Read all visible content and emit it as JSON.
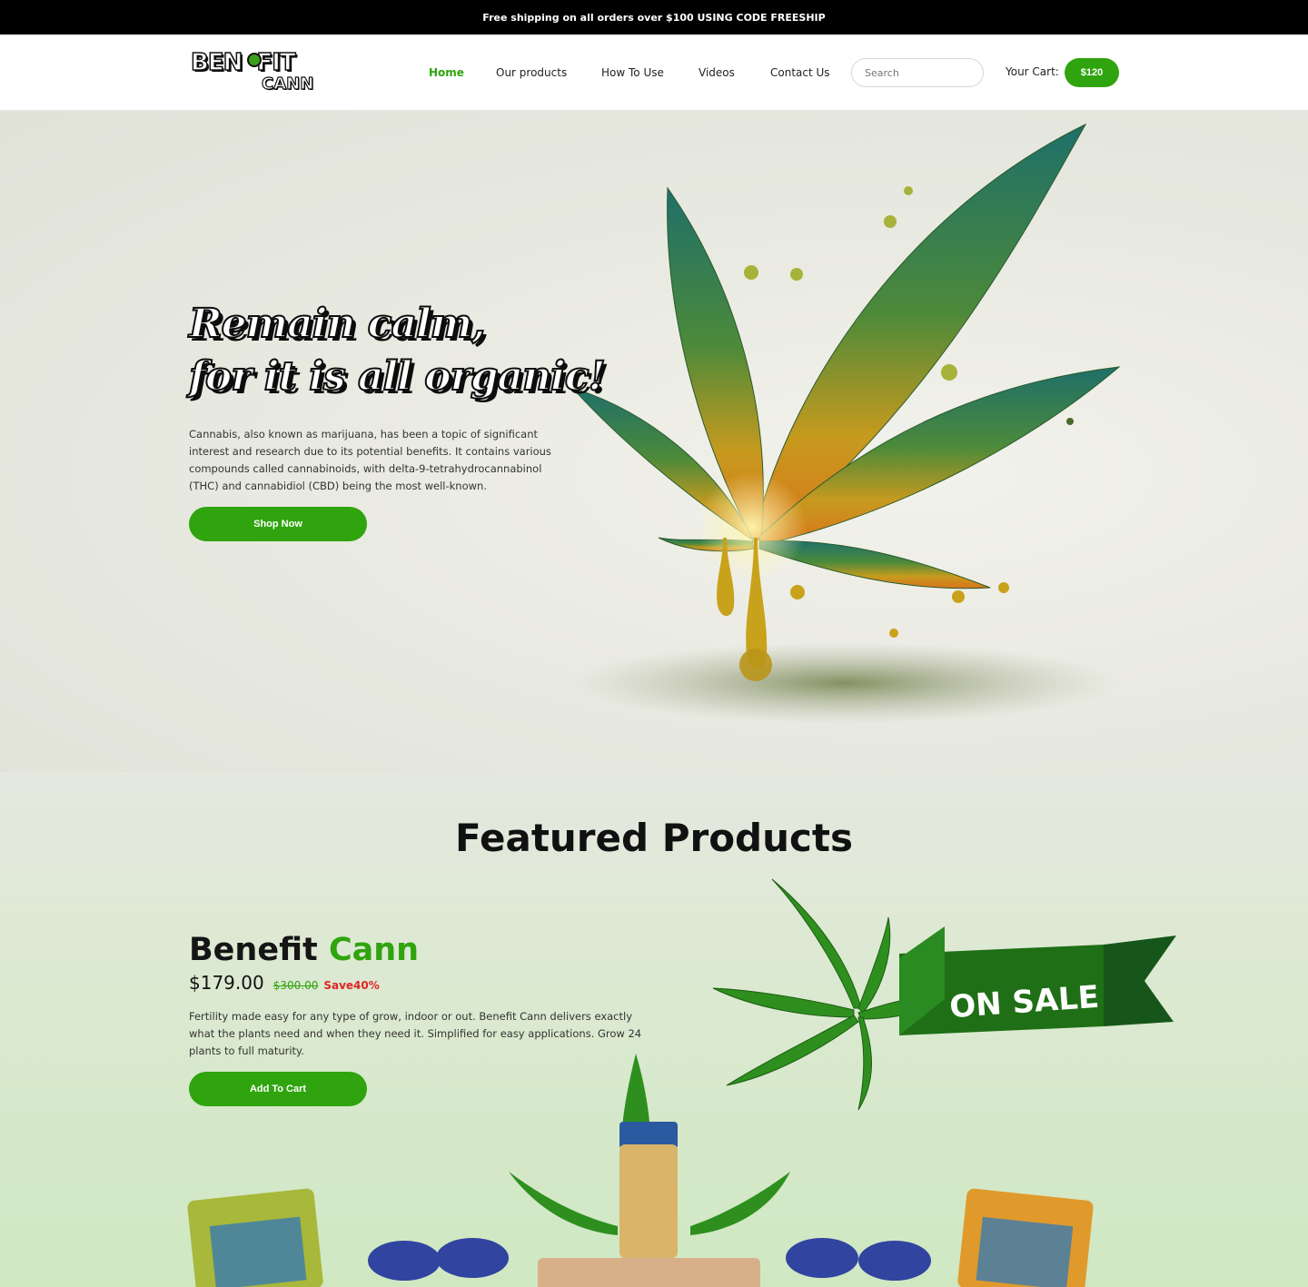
{
  "announcement": "Free shipping on all orders over $100 USING CODE FREESHIP",
  "logo": {
    "line1": "BEN",
    "line1b": "FIT",
    "line2": "CANN"
  },
  "nav": [
    {
      "label": "Home",
      "active": true
    },
    {
      "label": "Our products",
      "active": false
    },
    {
      "label": "How To Use",
      "active": false
    },
    {
      "label": "Videos",
      "active": false
    },
    {
      "label": "Contact Us",
      "active": false
    }
  ],
  "search": {
    "placeholder": "Search"
  },
  "cart": {
    "label": "Your Cart:",
    "value": "$120"
  },
  "hero": {
    "title_line1": "Remain calm,",
    "title_line2": "for it is all organic!",
    "description": "Cannabis, also known as marijuana, has been a topic of significant interest and research due to its potential benefits. It contains various compounds called cannabinoids, with delta-9-tetrahydrocannabinol (THC) and cannabidiol (CBD) being the most well-known.",
    "button": "Shop Now"
  },
  "featured": {
    "title": "Featured Products",
    "product": {
      "name": "Benefit",
      "name_accent": "Cann",
      "price": "$179.00",
      "old_price": "$300.00",
      "save": "Save40%",
      "description": "Fertility made easy for any type of grow, indoor or out. Benefit Cann delivers exactly what the plants need and when they need it. Simplified for easy applications. Grow 24 plants to full maturity.",
      "button": "Add To Cart",
      "badge": "ON SALE"
    }
  },
  "colors": {
    "accent": "#2fa40e",
    "sale": "#e02424",
    "topbar": "#000000"
  }
}
